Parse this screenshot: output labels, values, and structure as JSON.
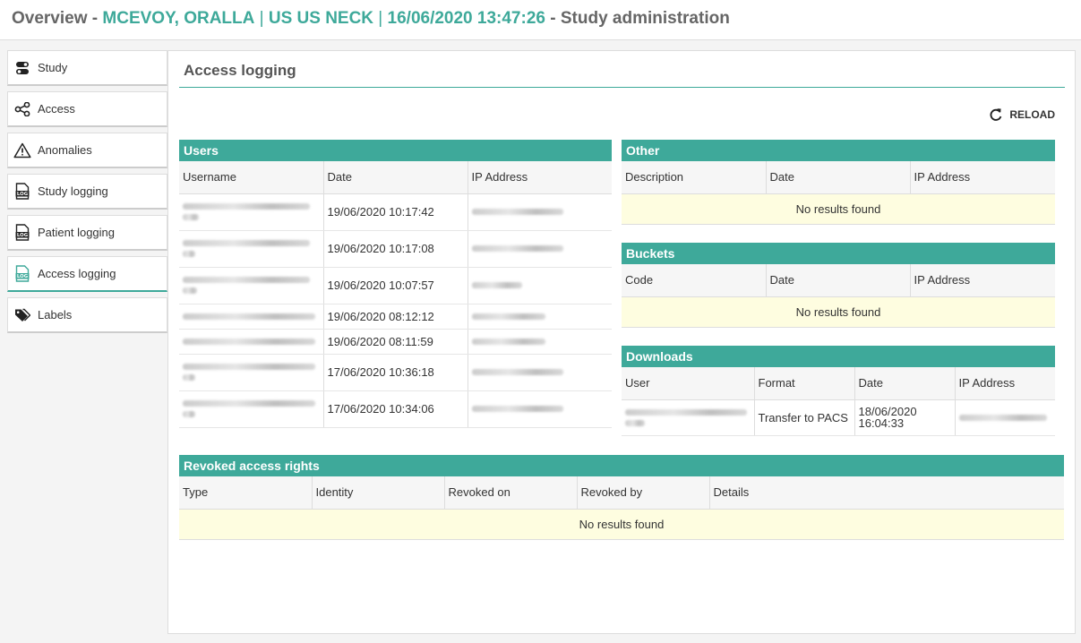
{
  "header": {
    "prefix": "Overview - ",
    "patient": "MCEVOY, ORALLA",
    "sep1": " | ",
    "study": "US US NECK",
    "sep2": " | ",
    "datetime": "16/06/2020 13:47:26",
    "suffix": " - Study administration"
  },
  "sidebar": {
    "items": [
      {
        "label": "Study",
        "icon": "toggle-icon"
      },
      {
        "label": "Access",
        "icon": "share-icon"
      },
      {
        "label": "Anomalies",
        "icon": "warning-icon"
      },
      {
        "label": "Study logging",
        "icon": "log-icon"
      },
      {
        "label": "Patient logging",
        "icon": "log-icon"
      },
      {
        "label": "Access logging",
        "icon": "log-icon"
      },
      {
        "label": "Labels",
        "icon": "tags-icon"
      }
    ],
    "active": "Access logging"
  },
  "main": {
    "title": "Access logging",
    "reload_label": "RELOAD"
  },
  "users": {
    "title": "Users",
    "columns": [
      "Username",
      "Date",
      "IP Address"
    ],
    "rows": [
      {
        "date": "19/06/2020 10:17:42"
      },
      {
        "date": "19/06/2020 10:17:08"
      },
      {
        "date": "19/06/2020 10:07:57"
      },
      {
        "date": "19/06/2020 08:12:12"
      },
      {
        "date": "19/06/2020 08:11:59"
      },
      {
        "date": "17/06/2020 10:36:18"
      },
      {
        "date": "17/06/2020 10:34:06"
      }
    ]
  },
  "other": {
    "title": "Other",
    "columns": [
      "Description",
      "Date",
      "IP Address"
    ],
    "empty": "No results found"
  },
  "buckets": {
    "title": "Buckets",
    "columns": [
      "Code",
      "Date",
      "IP Address"
    ],
    "empty": "No results found"
  },
  "downloads": {
    "title": "Downloads",
    "columns": [
      "User",
      "Format",
      "Date",
      "IP Address"
    ],
    "rows": [
      {
        "format": "Transfer to PACS",
        "date": "18/06/2020 16:04:33"
      }
    ]
  },
  "revoked": {
    "title": "Revoked access rights",
    "columns": [
      "Type",
      "Identity",
      "Revoked on",
      "Revoked by",
      "Details"
    ],
    "empty": "No results found"
  },
  "colors": {
    "accent": "#3ea99a",
    "empty_row": "#fefde0"
  }
}
